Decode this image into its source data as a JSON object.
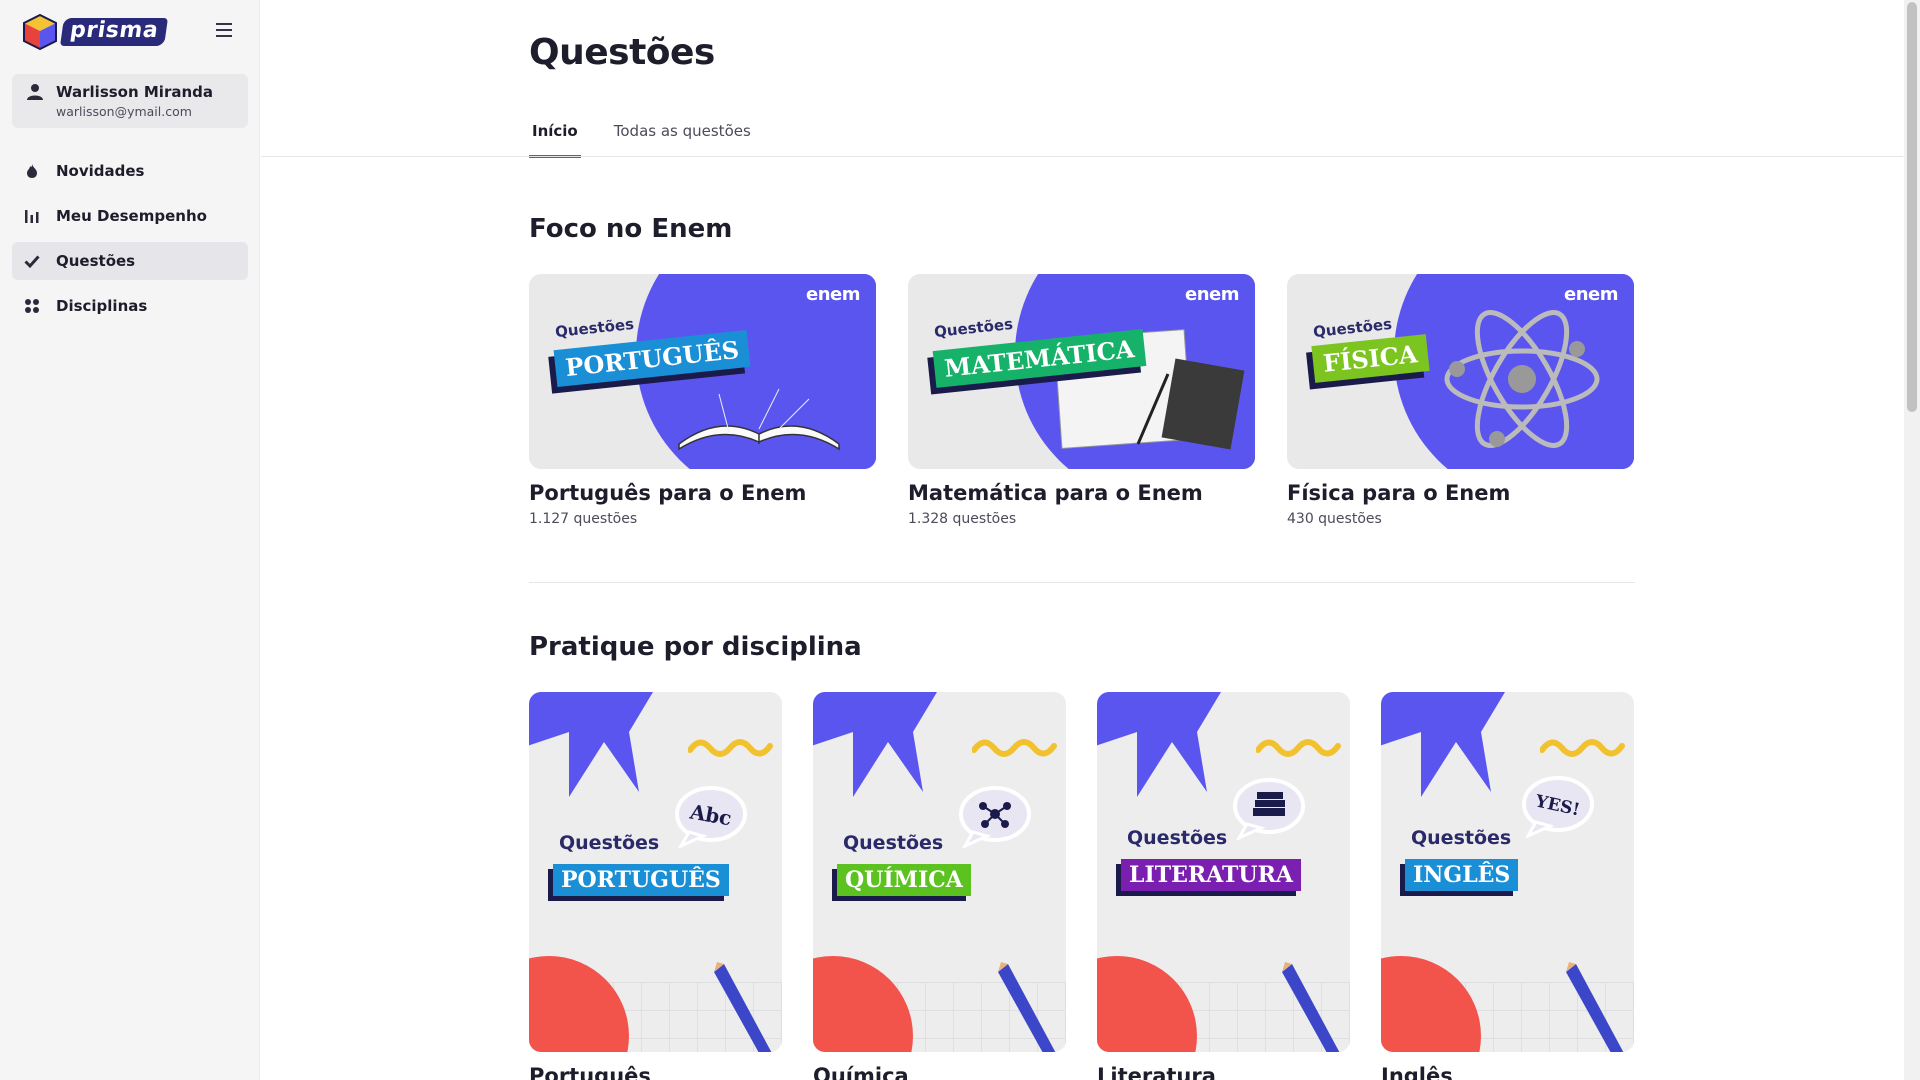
{
  "brand": {
    "name": "prisma"
  },
  "user": {
    "name": "Warlisson Miranda",
    "email": "warlisson@ymail.com"
  },
  "nav": [
    {
      "label": "Novidades",
      "icon": "flame-icon"
    },
    {
      "label": "Meu Desempenho",
      "icon": "bar-chart-icon"
    },
    {
      "label": "Questões",
      "icon": "check-icon",
      "active": true
    },
    {
      "label": "Disciplinas",
      "icon": "grid-dots-icon"
    }
  ],
  "page": {
    "title": "Questões"
  },
  "tabs": [
    {
      "label": "Início",
      "active": true
    },
    {
      "label": "Todas as questões"
    }
  ],
  "sections": {
    "enem": "Foco no Enem",
    "disciplines": "Pratique por disciplina"
  },
  "enem_cards": [
    {
      "name": "Português para o Enem",
      "count": "1.127 questões",
      "banner_label": "Questões",
      "banner_tag": "PORTUGUÊS",
      "tag_color": "#1b8fd6",
      "logo": "enem"
    },
    {
      "name": "Matemática para o Enem",
      "count": "1.328 questões",
      "banner_label": "Questões",
      "banner_tag": "MATEMÁTICA",
      "tag_color": "#17b26a",
      "logo": "enem"
    },
    {
      "name": "Física para o Enem",
      "count": "430 questões",
      "banner_label": "Questões",
      "banner_tag": "FÍSICA",
      "tag_color": "#7cc41f",
      "logo": "enem"
    }
  ],
  "discipline_cards": [
    {
      "name": "Português",
      "banner_label": "Questões",
      "banner_tag": "PORTUGUÊS",
      "tag_color": "#1b8fd6",
      "bubble": "Abc"
    },
    {
      "name": "Química",
      "banner_label": "Questões",
      "banner_tag": "QUÍMICA",
      "tag_color": "#5cc21f",
      "bubble": ""
    },
    {
      "name": "Literatura",
      "banner_label": "Questões",
      "banner_tag": "LITERATURA",
      "tag_color": "#7a1fb0",
      "bubble": ""
    },
    {
      "name": "Inglês",
      "banner_label": "Questões",
      "banner_tag": "INGLÊS",
      "tag_color": "#1b8fd6",
      "bubble": "YES!"
    }
  ],
  "colors": {
    "accent": "#5b4ff5",
    "brand_dark": "#2a2a7a",
    "banner_purple": "#5b55f0",
    "banner_red": "#f2544c",
    "banner_yellow": "#f2c12e"
  }
}
